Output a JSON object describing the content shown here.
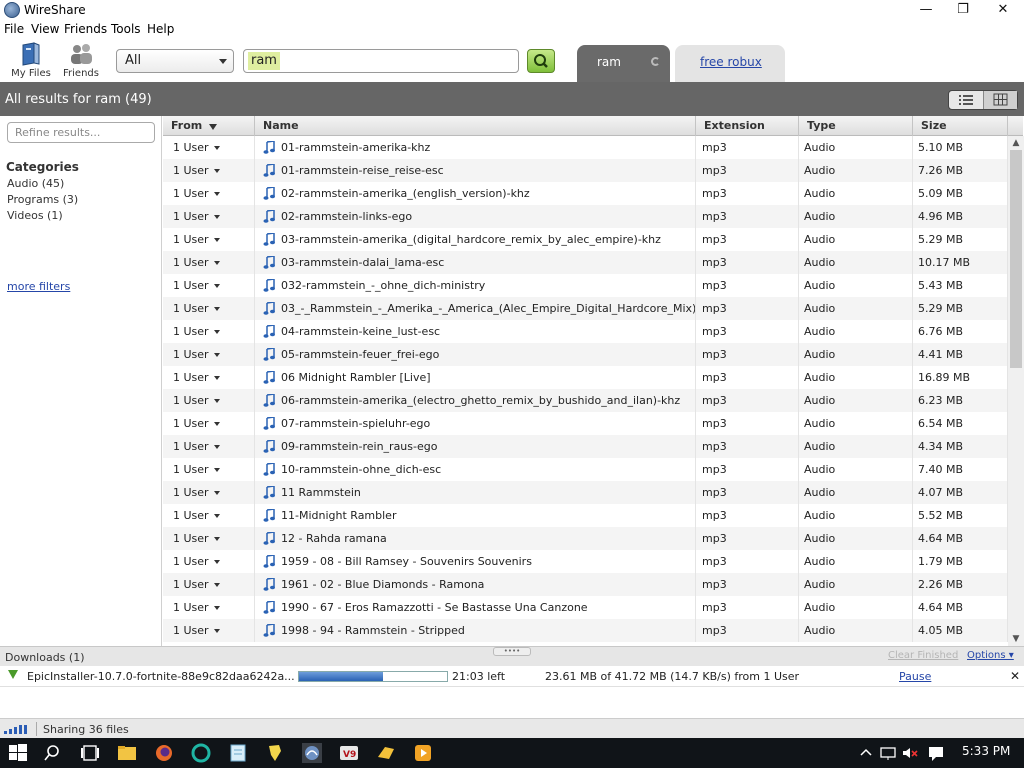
{
  "window": {
    "title": "WireShare",
    "minimize": "—",
    "maximize": "❐",
    "close": "✕"
  },
  "menu": [
    "File",
    "View",
    "Friends",
    "Tools",
    "Help"
  ],
  "toolbar": {
    "my_files": "My Files",
    "friends": "Friends",
    "search_type": "All",
    "search_value": "ram",
    "tabs": [
      {
        "label": "ram",
        "active": true
      },
      {
        "label": "free robux",
        "active": false
      }
    ]
  },
  "results": {
    "heading": "All results for ram (49)"
  },
  "sidebar": {
    "refine_placeholder": "Refine results...",
    "categories_title": "Categories",
    "categories": [
      "Audio (45)",
      "Programs (3)",
      "Videos (1)"
    ],
    "more_filters": "more filters"
  },
  "table": {
    "columns": [
      "From",
      "Name",
      "Extension",
      "Type",
      "Size"
    ],
    "rows": [
      {
        "from": "1 User",
        "name": "01-rammstein-amerika-khz",
        "ext": "mp3",
        "type": "Audio",
        "size": "5.10 MB"
      },
      {
        "from": "1 User",
        "name": "01-rammstein-reise_reise-esc",
        "ext": "mp3",
        "type": "Audio",
        "size": "7.26 MB"
      },
      {
        "from": "1 User",
        "name": "02-rammstein-amerika_(english_version)-khz",
        "ext": "mp3",
        "type": "Audio",
        "size": "5.09 MB"
      },
      {
        "from": "1 User",
        "name": "02-rammstein-links-ego",
        "ext": "mp3",
        "type": "Audio",
        "size": "4.96 MB"
      },
      {
        "from": "1 User",
        "name": "03-rammstein-amerika_(digital_hardcore_remix_by_alec_empire)-khz",
        "ext": "mp3",
        "type": "Audio",
        "size": "5.29 MB"
      },
      {
        "from": "1 User",
        "name": "03-rammstein-dalai_lama-esc",
        "ext": "mp3",
        "type": "Audio",
        "size": "10.17 MB"
      },
      {
        "from": "1 User",
        "name": "032-rammstein_-_ohne_dich-ministry",
        "ext": "mp3",
        "type": "Audio",
        "size": "5.43 MB"
      },
      {
        "from": "1 User",
        "name": "03_-_Rammstein_-_Amerika_-_America_(Alec_Empire_Digital_Hardcore_Mix)",
        "ext": "mp3",
        "type": "Audio",
        "size": "5.29 MB"
      },
      {
        "from": "1 User",
        "name": "04-rammstein-keine_lust-esc",
        "ext": "mp3",
        "type": "Audio",
        "size": "6.76 MB"
      },
      {
        "from": "1 User",
        "name": "05-rammstein-feuer_frei-ego",
        "ext": "mp3",
        "type": "Audio",
        "size": "4.41 MB"
      },
      {
        "from": "1 User",
        "name": "06 Midnight Rambler [Live]",
        "ext": "mp3",
        "type": "Audio",
        "size": "16.89 MB"
      },
      {
        "from": "1 User",
        "name": "06-rammstein-amerika_(electro_ghetto_remix_by_bushido_and_ilan)-khz",
        "ext": "mp3",
        "type": "Audio",
        "size": "6.23 MB"
      },
      {
        "from": "1 User",
        "name": "07-rammstein-spieluhr-ego",
        "ext": "mp3",
        "type": "Audio",
        "size": "6.54 MB"
      },
      {
        "from": "1 User",
        "name": "09-rammstein-rein_raus-ego",
        "ext": "mp3",
        "type": "Audio",
        "size": "4.34 MB"
      },
      {
        "from": "1 User",
        "name": "10-rammstein-ohne_dich-esc",
        "ext": "mp3",
        "type": "Audio",
        "size": "7.40 MB"
      },
      {
        "from": "1 User",
        "name": "11 Rammstein",
        "ext": "mp3",
        "type": "Audio",
        "size": "4.07 MB"
      },
      {
        "from": "1 User",
        "name": "11-Midnight Rambler",
        "ext": "mp3",
        "type": "Audio",
        "size": "5.52 MB"
      },
      {
        "from": "1 User",
        "name": "12 - Rahda ramana",
        "ext": "mp3",
        "type": "Audio",
        "size": "4.64 MB"
      },
      {
        "from": "1 User",
        "name": "1959 - 08 - Bill Ramsey - Souvenirs Souvenirs",
        "ext": "mp3",
        "type": "Audio",
        "size": "1.79 MB"
      },
      {
        "from": "1 User",
        "name": "1961 - 02 - Blue Diamonds - Ramona",
        "ext": "mp3",
        "type": "Audio",
        "size": "2.26 MB"
      },
      {
        "from": "1 User",
        "name": "1990 - 67 - Eros Ramazzotti  - Se Bastasse Una Canzone",
        "ext": "mp3",
        "type": "Audio",
        "size": "4.64 MB"
      },
      {
        "from": "1 User",
        "name": "1998 - 94 - Rammstein  - Stripped",
        "ext": "mp3",
        "type": "Audio",
        "size": "4.05 MB"
      }
    ]
  },
  "downloads": {
    "title": "Downloads (1)",
    "clear_finished": "Clear Finished",
    "options": "Options ▾",
    "item": {
      "name": "EpicInstaller-10.7.0-fortnite-88e9c82daa6242a...",
      "progress": 0.566,
      "time_left": "21:03 left",
      "status": "23.61 MB of 41.72 MB (14.7 KB/s) from 1 User",
      "pause": "Pause",
      "close": "✕"
    }
  },
  "status": {
    "sharing": "Sharing 36 files"
  },
  "taskbar": {
    "clock": "5:33 PM"
  },
  "colors": {
    "accent": "#2546a8",
    "header_gray": "#666666",
    "progress": "#2a62b4"
  }
}
